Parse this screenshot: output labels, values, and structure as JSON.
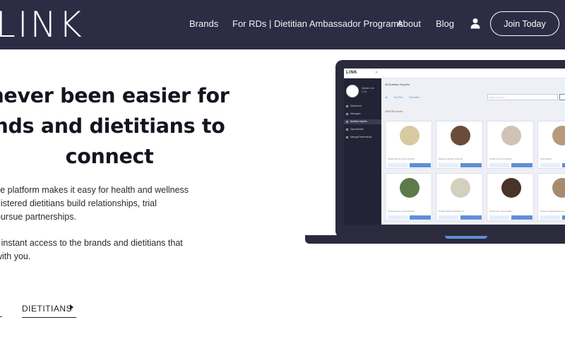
{
  "brand": {
    "logo_text": "LINK"
  },
  "nav": {
    "links": [
      "Brands",
      "For RDs | Dietitian Ambassador Programs",
      "About",
      "Blog"
    ],
    "join_label": "Join Today",
    "user_icon": "user-icon"
  },
  "hero": {
    "headline_lines": [
      "never been easier for",
      "nds and dietitians to",
      "connect"
    ],
    "paragraph1_lines": [
      "ve platform makes it easy for health and wellness",
      "gistered dietitians build relationships, trial",
      "oursue partnerships."
    ],
    "paragraph2_lines": [
      "r instant access to the brands and dietitians that",
      "with you."
    ],
    "cta_dietitians": "DIETITIANS"
  },
  "app_preview": {
    "logo": "LINK",
    "user_name": "Natalie Lee",
    "user_meta": "⚲ 24",
    "sidebar": [
      "Dashboard",
      "Messages",
      "Nutrition Experts",
      "Opportunities",
      "Manage Partnerships"
    ],
    "active_index": 2,
    "title": "All Nutrition Experts",
    "tabs": [
      "All",
      "My RDs",
      "Favorites"
    ],
    "search_placeholder": "Search by name",
    "found_text": "2648 RDs found",
    "cards": [
      {
        "name": "Dietitian with 401 Forever Website",
        "color": "#d9c9a3"
      },
      {
        "name": "Registered Dietitian Nutritionist",
        "color": "#6b4b3a"
      },
      {
        "name": "Nutrition Coach and Dietitian",
        "color": "#cfc3b5"
      },
      {
        "name": "Public Dietitian",
        "color": "#b89a7a"
      },
      {
        "name": "Private practice, Licensed Dietitian",
        "color": "#5e7a4a"
      },
      {
        "name": "Dietitian Nutritionist, Weight Loss",
        "color": "#d4d0c0"
      },
      {
        "name": "Performance, Sports Dietitian",
        "color": "#4a3328"
      },
      {
        "name": "Wellness, Weight Management",
        "color": "#a88b6f"
      }
    ]
  },
  "colors": {
    "nav_bg": "#2c2c44",
    "accent": "#5f8fd6"
  }
}
